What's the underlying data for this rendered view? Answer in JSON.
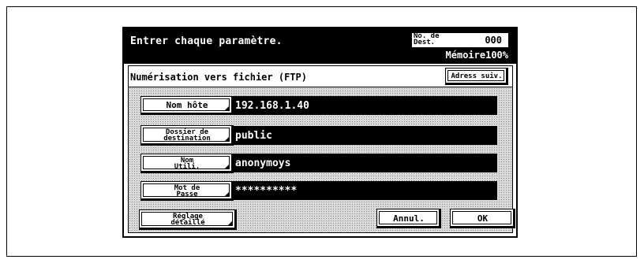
{
  "header": {
    "title": "Entrer chaque paramètre.",
    "dest_label": "No. de Dest.",
    "dest_value": "000",
    "memory": "Mémoire100%"
  },
  "section": {
    "title": "Numérisation vers fichier (FTP)",
    "next_address_button": "Adress suiv."
  },
  "fields": [
    {
      "label": "Nom hôte",
      "value": "192.168.1.40"
    },
    {
      "label": "Dossier de destination",
      "value": "public"
    },
    {
      "label": "Nom Utili.",
      "value": "anonymoys"
    },
    {
      "label": "Mot de Passe",
      "value": "**********"
    }
  ],
  "footer": {
    "detail_button": "Réglage détaillé",
    "cancel_button": "Annul.",
    "ok_button": "OK"
  }
}
